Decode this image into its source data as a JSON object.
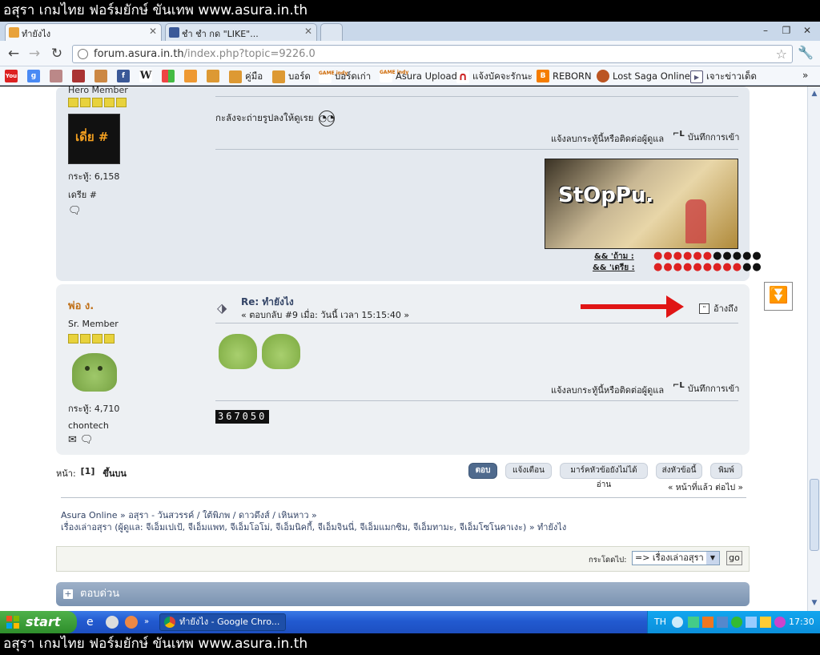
{
  "banner": {
    "text": "อสุรา เกมไทย ฟอร์มยักษ์ ขันเทพ www.asura.in.th"
  },
  "browser": {
    "tabs": [
      {
        "label": "ทำยังไง",
        "active": true,
        "icon": "asura-favicon"
      },
      {
        "label": "ชำ ชำ กด \"LIKE\"...",
        "active": false,
        "icon": "facebook-icon"
      }
    ],
    "url": {
      "host": "forum.asura.in.th",
      "path": "/index.php?topic=9226.0"
    },
    "bookmarks": [
      {
        "label": "",
        "icon": "youtube-icon"
      },
      {
        "label": "",
        "icon": "google-icon"
      },
      {
        "label": "",
        "icon": "bookmark-icon"
      },
      {
        "label": "",
        "icon": "bookmark-icon"
      },
      {
        "label": "",
        "icon": "bookmark-icon"
      },
      {
        "label": "",
        "icon": "facebook-icon"
      },
      {
        "label": "",
        "icon": "wikipedia-icon"
      },
      {
        "label": "",
        "icon": "windows-icon"
      },
      {
        "label": "",
        "icon": "bookmark-icon"
      },
      {
        "label": "",
        "icon": "bookmark-icon"
      },
      {
        "label": "คู่มือ",
        "icon": "asura-icon"
      },
      {
        "label": "บอร์ด",
        "icon": "asura-icon"
      },
      {
        "label": "บอร์ดเก่า",
        "icon": "gameindy-icon"
      },
      {
        "label": "Asura Upload",
        "icon": "gameindy-icon"
      },
      {
        "label": "แจ้งบัคจะรักนะ",
        "icon": "bookmark-icon"
      },
      {
        "label": "REBORN",
        "icon": "blogger-icon"
      },
      {
        "label": "Lost Saga Online",
        "icon": "lostsaga-icon"
      },
      {
        "label": "เจาะข่าวเด็ด",
        "icon": "video-icon"
      }
    ]
  },
  "post1": {
    "rank": "Hero Member",
    "avatar_text": "เดี่ย #",
    "posts_count": "กระทู้: 6,158",
    "personal_text": "เดรีย #",
    "message": "กะลังจะถ่ายรูปลงให้ดูเรย",
    "report_link": "แจ้งลบกระทู้นี้หรือติดต่อผู้ดูแล",
    "logged_ip": "บันทึกการเข้า",
    "signature_banner": "StOpPu.",
    "sig_line1": "&&    'ถ้าม :",
    "sig_line2": "&&    'เดรีย :"
  },
  "post2": {
    "username": "พ่อ ง.",
    "rank": "Sr. Member",
    "posts_count": "กระทู้: 4,710",
    "personal_text": "chontech",
    "subject": "Re: ทำยังไง",
    "reply_info": "« ตอบกลับ #9 เมื่อ: วันนี้ เวลา 15:15:40 »",
    "quote_button": "อ้างถึง",
    "report_link": "แจ้งลบกระทู้นี้หรือติดต่อผู้ดูแล",
    "logged_ip": "บันทึกการเข้า",
    "counter": "367050"
  },
  "pagination": {
    "pages_label": "หน้า:",
    "current_page": "[1]",
    "go_up": "ขึ้นบน",
    "buttons": [
      "ตอบ",
      "แจ้งเตือน",
      "มาร์คหัวข้อยังไม่ได้อ่าน",
      "ส่งหัวข้อนี้",
      "พิมพ์"
    ],
    "prev_next": "« หน้าที่แล้ว ต่อไป »"
  },
  "breadcrumb": {
    "line1": "Asura Online » อสุรา - วันสวรรค์ / ใต้พิภพ / ดาวดึงส์ / เหินหาว »",
    "line2": "เรื่องเล่าอสุรา (ผู้ดูแล: จีเอ็มเปเป้, จีเอ็มแพท, จีเอ็มโอโม่, จีเอ็มนิคกี้, จีเอ็มจินนี่, จีเอ็มแมกซิม, จีเอ็มทามะ, จีเอ็มโซโนคาเงะ) » ทำยังไง"
  },
  "jump": {
    "label": "กระโดดไป:",
    "selected": "=> เรื่องเล่าอสุรา",
    "go": "go"
  },
  "quick_reply": {
    "label": "ตอบด่วน"
  },
  "taskbar": {
    "start": "start",
    "task": "ทำยังไง - Google Chro...",
    "lang": "TH",
    "clock": "17:30"
  },
  "colors": {
    "username": "#c0711a",
    "link": "#334466",
    "arrow": "#e01515"
  }
}
